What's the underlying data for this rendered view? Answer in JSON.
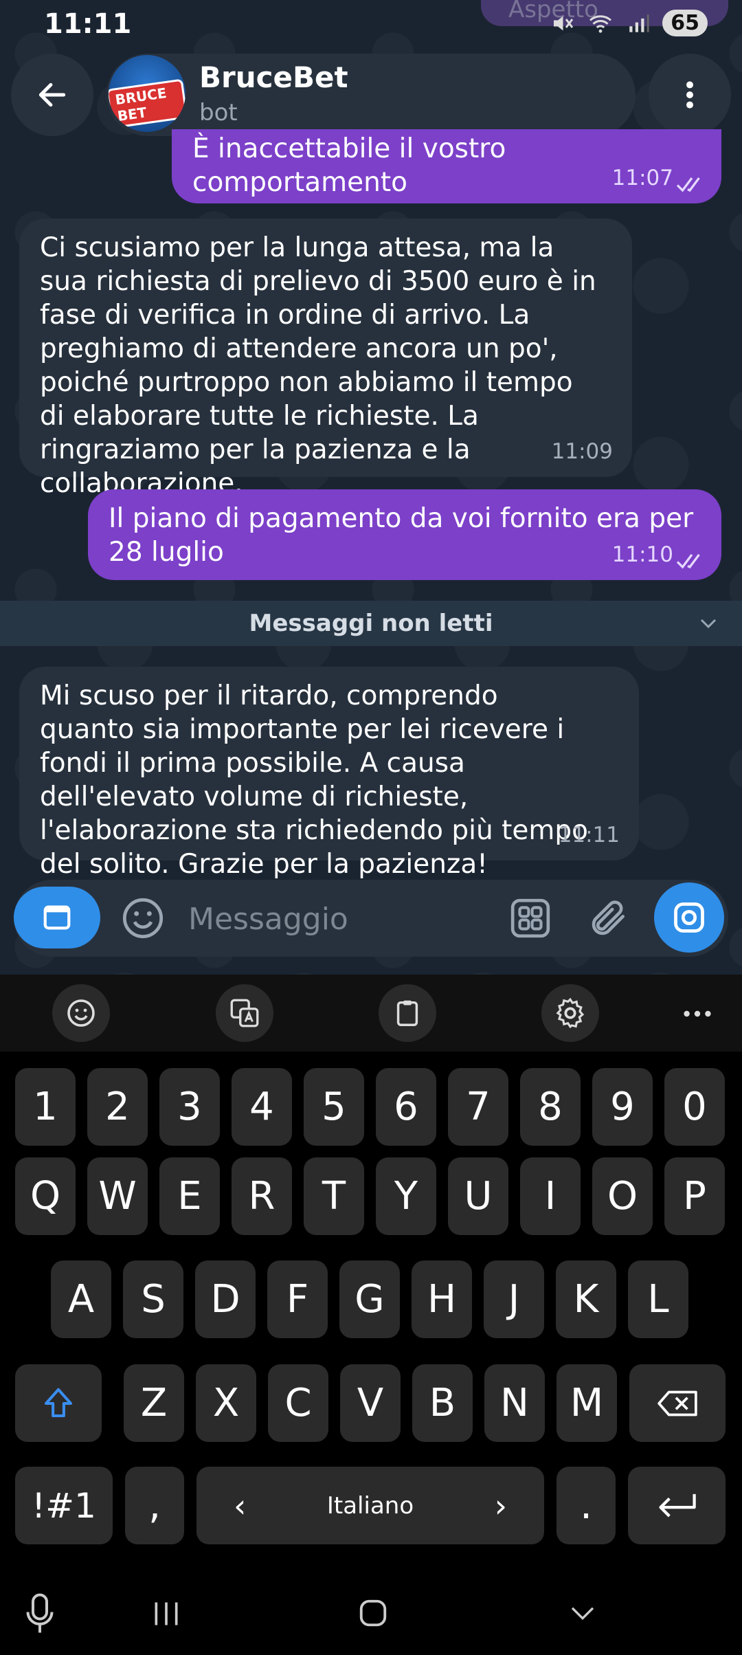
{
  "status": {
    "time": "11:11",
    "battery": "65"
  },
  "ghost_text": "Aspetto",
  "header": {
    "title": "BruceBet",
    "subtitle": "bot",
    "avatar_text": "BRUCE BET"
  },
  "messages": [
    {
      "dir": "out",
      "text": "È inaccettabile il vostro comportamento",
      "time": "11:07"
    },
    {
      "dir": "in",
      "text": "Ci scusiamo per la lunga attesa, ma la sua richiesta di prelievo di 3500 euro è in fase di verifica in ordine di arrivo. La preghiamo di attendere ancora un po', poiché purtroppo non abbiamo il tempo di elaborare tutte le richieste. La ringraziamo per la pazienza e la collaborazione.",
      "time": "11:09"
    },
    {
      "dir": "out",
      "text": "Il piano di pagamento da voi fornito era per 28 luglio",
      "time": "11:10"
    },
    {
      "dir": "in",
      "text": "Mi scuso per il ritardo, comprendo quanto sia importante per lei ricevere i fondi il prima possibile. A causa dell'elevato volume di richieste, l'elaborazione sta richiedendo più tempo del solito. Grazie per la pazienza!",
      "time": "11:11"
    }
  ],
  "unread_label": "Messaggi non letti",
  "input": {
    "placeholder": "Messaggio"
  },
  "keyboard": {
    "row_numbers": [
      "1",
      "2",
      "3",
      "4",
      "5",
      "6",
      "7",
      "8",
      "9",
      "0"
    ],
    "row1": [
      "Q",
      "W",
      "E",
      "R",
      "T",
      "Y",
      "U",
      "I",
      "O",
      "P"
    ],
    "row2": [
      "A",
      "S",
      "D",
      "F",
      "G",
      "H",
      "J",
      "K",
      "L"
    ],
    "row3": [
      "Z",
      "X",
      "C",
      "V",
      "B",
      "N",
      "M"
    ],
    "symbols_key": "!#1",
    "comma_key": ",",
    "space_label": "Italiano",
    "period_key": ".",
    "space_left": "‹",
    "space_right": "›"
  },
  "colors": {
    "outgoing_bubble": "#7c40c9",
    "incoming_bubble": "#27313d",
    "accent": "#2f8ee8"
  }
}
